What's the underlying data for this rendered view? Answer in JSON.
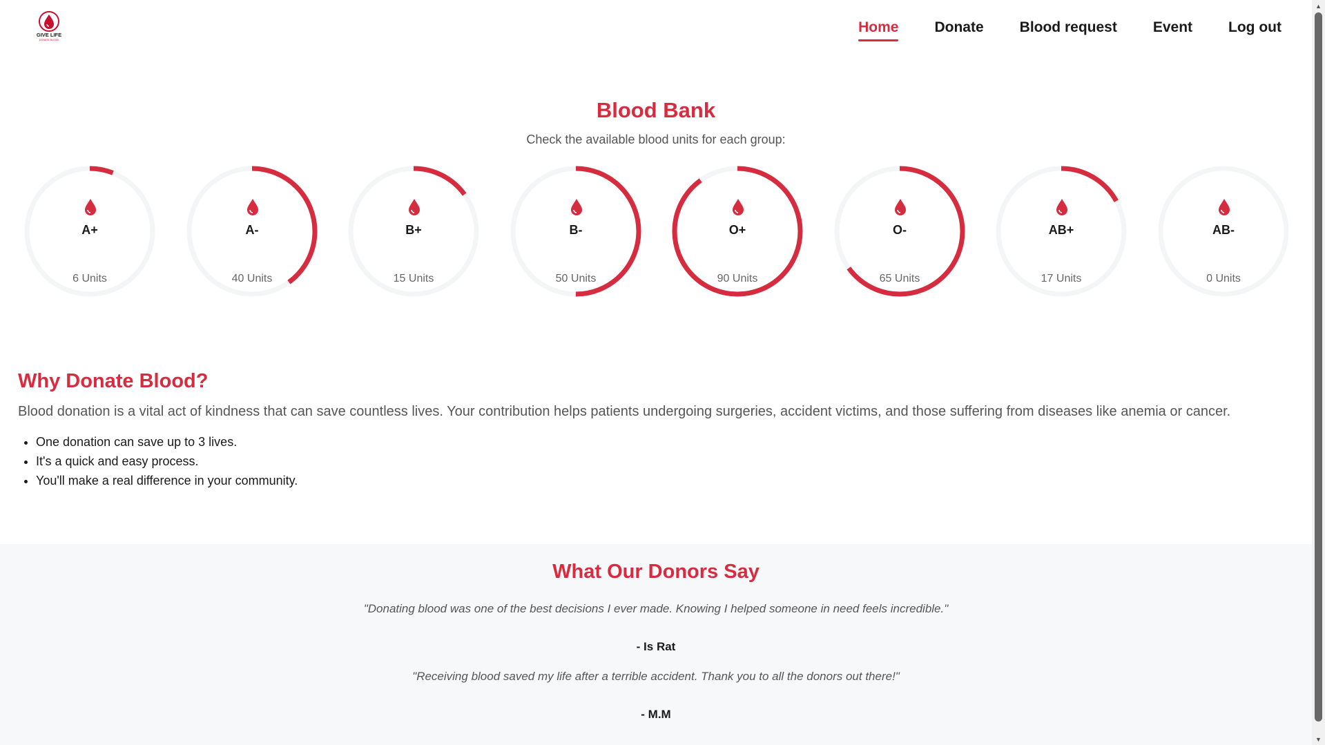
{
  "header": {
    "logo_text": "GIVE LIFE",
    "logo_subtext": "DONATE BLOOD",
    "nav": [
      {
        "label": "Home",
        "active": true
      },
      {
        "label": "Donate",
        "active": false
      },
      {
        "label": "Blood request",
        "active": false
      },
      {
        "label": "Event",
        "active": false
      },
      {
        "label": "Log out",
        "active": false
      }
    ]
  },
  "blood_bank": {
    "title": "Blood Bank",
    "subtitle": "Check the available blood units for each group:",
    "max_units": 100,
    "groups": [
      {
        "group": "A+",
        "units": 6,
        "label": "6 Units"
      },
      {
        "group": "A-",
        "units": 40,
        "label": "40 Units"
      },
      {
        "group": "B+",
        "units": 15,
        "label": "15 Units"
      },
      {
        "group": "B-",
        "units": 50,
        "label": "50 Units"
      },
      {
        "group": "O+",
        "units": 90,
        "label": "90 Units"
      },
      {
        "group": "O-",
        "units": 65,
        "label": "65 Units"
      },
      {
        "group": "AB+",
        "units": 17,
        "label": "17 Units"
      },
      {
        "group": "AB-",
        "units": 0,
        "label": "0 Units"
      }
    ],
    "icon": "blood-drop-icon"
  },
  "why_donate": {
    "title": "Why Donate Blood?",
    "text": "Blood donation is a vital act of kindness that can save countless lives. Your contribution helps patients undergoing surgeries, accident victims, and those suffering from diseases like anemia or cancer.",
    "points": [
      "One donation can save up to 3 lives.",
      "It's a quick and easy process.",
      "You'll make a real difference in your community."
    ]
  },
  "testimonials": {
    "title": "What Our Donors Say",
    "items": [
      {
        "quote": "\"Donating blood was one of the best decisions I ever made. Knowing I helped someone in need feels incredible.\"",
        "author": "- Is Rat"
      },
      {
        "quote": "\"Receiving blood saved my life after a terrible accident. Thank you to all the donors out there!\"",
        "author": "- M.M"
      }
    ]
  },
  "colors": {
    "accent": "#d62c3f",
    "track": "#f4f5f6",
    "section_bg": "#f7f8fa"
  }
}
